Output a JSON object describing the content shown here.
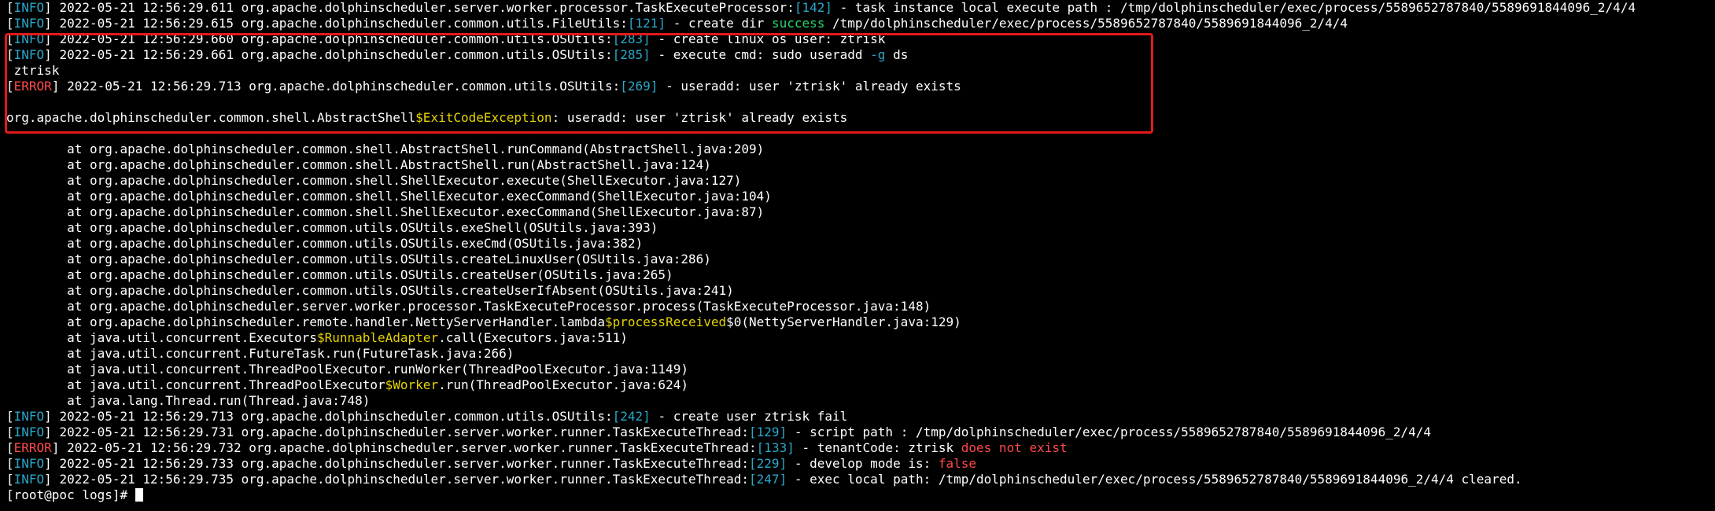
{
  "colors": {
    "background": "#000000",
    "text": "#ffffff",
    "level_info": "#2aa7c9",
    "level_error": "#ff4a4a",
    "line_number": "#2aa7c9",
    "success": "#2ad36a",
    "false_keyword": "#ff4a4a",
    "inner_class": "#e6d300",
    "flag": "#2aa7c9",
    "highlight_box": "#e21a1a"
  },
  "lines": [
    [
      {
        "t": "[",
        "c": "white"
      },
      {
        "t": "INFO",
        "c": "cyan"
      },
      {
        "t": "] 2022-05-21 12:56:29.611 org.apache.dolphinscheduler.server.worker.processor.TaskExecuteProcessor:",
        "c": "white"
      },
      {
        "t": "[142]",
        "c": "cyan"
      },
      {
        "t": " - task instance local execute path : /tmp/dolphinscheduler/exec/process/5589652787840/5589691844096_2/4/4",
        "c": "white"
      }
    ],
    [
      {
        "t": "[",
        "c": "white"
      },
      {
        "t": "INFO",
        "c": "cyan"
      },
      {
        "t": "] 2022-05-21 12:56:29.615 org.apache.dolphinscheduler.common.utils.FileUtils:",
        "c": "white"
      },
      {
        "t": "[121]",
        "c": "cyan"
      },
      {
        "t": " - create dir ",
        "c": "white"
      },
      {
        "t": "success",
        "c": "green"
      },
      {
        "t": " /tmp/dolphinscheduler/exec/process/5589652787840/5589691844096_2/4/4",
        "c": "white"
      }
    ],
    [
      {
        "t": "[",
        "c": "white"
      },
      {
        "t": "INFO",
        "c": "cyan"
      },
      {
        "t": "] 2022-05-21 12:56:29.660 org.apache.dolphinscheduler.common.utils.OSUtils:",
        "c": "white"
      },
      {
        "t": "[283]",
        "c": "cyan"
      },
      {
        "t": " - create linux os user: ztrisk",
        "c": "white"
      }
    ],
    [
      {
        "t": "[",
        "c": "white"
      },
      {
        "t": "INFO",
        "c": "cyan"
      },
      {
        "t": "] 2022-05-21 12:56:29.661 org.apache.dolphinscheduler.common.utils.OSUtils:",
        "c": "white"
      },
      {
        "t": "[285]",
        "c": "cyan"
      },
      {
        "t": " - execute cmd: sudo useradd ",
        "c": "white"
      },
      {
        "t": "-g",
        "c": "blue"
      },
      {
        "t": " ds",
        "c": "white"
      }
    ],
    [
      {
        "t": " ztrisk",
        "c": "white"
      }
    ],
    [
      {
        "t": "[",
        "c": "white"
      },
      {
        "t": "ERROR",
        "c": "red"
      },
      {
        "t": "] 2022-05-21 12:56:29.713 org.apache.dolphinscheduler.common.utils.OSUtils:",
        "c": "white"
      },
      {
        "t": "[269]",
        "c": "cyan"
      },
      {
        "t": " - useradd: user 'ztrisk' already exists",
        "c": "white"
      }
    ],
    [
      {
        "t": "",
        "c": "white"
      }
    ],
    [
      {
        "t": "org.apache.dolphinscheduler.common.shell.AbstractShell",
        "c": "white"
      },
      {
        "t": "$ExitCodeException",
        "c": "yellow"
      },
      {
        "t": ": useradd: user 'ztrisk' already exists",
        "c": "white"
      }
    ],
    [
      {
        "t": "",
        "c": "white"
      }
    ],
    [
      {
        "t": "        at org.apache.dolphinscheduler.common.shell.AbstractShell.runCommand(AbstractShell.java:209)",
        "c": "white"
      }
    ],
    [
      {
        "t": "        at org.apache.dolphinscheduler.common.shell.AbstractShell.run(AbstractShell.java:124)",
        "c": "white"
      }
    ],
    [
      {
        "t": "        at org.apache.dolphinscheduler.common.shell.ShellExecutor.execute(ShellExecutor.java:127)",
        "c": "white"
      }
    ],
    [
      {
        "t": "        at org.apache.dolphinscheduler.common.shell.ShellExecutor.execCommand(ShellExecutor.java:104)",
        "c": "white"
      }
    ],
    [
      {
        "t": "        at org.apache.dolphinscheduler.common.shell.ShellExecutor.execCommand(ShellExecutor.java:87)",
        "c": "white"
      }
    ],
    [
      {
        "t": "        at org.apache.dolphinscheduler.common.utils.OSUtils.exeShell(OSUtils.java:393)",
        "c": "white"
      }
    ],
    [
      {
        "t": "        at org.apache.dolphinscheduler.common.utils.OSUtils.exeCmd(OSUtils.java:382)",
        "c": "white"
      }
    ],
    [
      {
        "t": "        at org.apache.dolphinscheduler.common.utils.OSUtils.createLinuxUser(OSUtils.java:286)",
        "c": "white"
      }
    ],
    [
      {
        "t": "        at org.apache.dolphinscheduler.common.utils.OSUtils.createUser(OSUtils.java:265)",
        "c": "white"
      }
    ],
    [
      {
        "t": "        at org.apache.dolphinscheduler.common.utils.OSUtils.createUserIfAbsent(OSUtils.java:241)",
        "c": "white"
      }
    ],
    [
      {
        "t": "        at org.apache.dolphinscheduler.server.worker.processor.TaskExecuteProcessor.process(TaskExecuteProcessor.java:148)",
        "c": "white"
      }
    ],
    [
      {
        "t": "        at org.apache.dolphinscheduler.remote.handler.NettyServerHandler.lambda",
        "c": "white"
      },
      {
        "t": "$processReceived",
        "c": "yellow"
      },
      {
        "t": "$0(NettyServerHandler.java:129)",
        "c": "white"
      }
    ],
    [
      {
        "t": "        at java.util.concurrent.Executors",
        "c": "white"
      },
      {
        "t": "$RunnableAdapter",
        "c": "yellow"
      },
      {
        "t": ".call(Executors.java:511)",
        "c": "white"
      }
    ],
    [
      {
        "t": "        at java.util.concurrent.FutureTask.run(FutureTask.java:266)",
        "c": "white"
      }
    ],
    [
      {
        "t": "        at java.util.concurrent.ThreadPoolExecutor.runWorker(ThreadPoolExecutor.java:1149)",
        "c": "white"
      }
    ],
    [
      {
        "t": "        at java.util.concurrent.ThreadPoolExecutor",
        "c": "white"
      },
      {
        "t": "$Worker",
        "c": "yellow"
      },
      {
        "t": ".run(ThreadPoolExecutor.java:624)",
        "c": "white"
      }
    ],
    [
      {
        "t": "        at java.lang.Thread.run(Thread.java:748)",
        "c": "white"
      }
    ],
    [
      {
        "t": "[",
        "c": "white"
      },
      {
        "t": "INFO",
        "c": "cyan"
      },
      {
        "t": "] 2022-05-21 12:56:29.713 org.apache.dolphinscheduler.common.utils.OSUtils:",
        "c": "white"
      },
      {
        "t": "[242]",
        "c": "cyan"
      },
      {
        "t": " - create user ztrisk fail",
        "c": "white"
      }
    ],
    [
      {
        "t": "[",
        "c": "white"
      },
      {
        "t": "INFO",
        "c": "cyan"
      },
      {
        "t": "] 2022-05-21 12:56:29.731 org.apache.dolphinscheduler.server.worker.runner.TaskExecuteThread:",
        "c": "white"
      },
      {
        "t": "[129]",
        "c": "cyan"
      },
      {
        "t": " - script path : /tmp/dolphinscheduler/exec/process/5589652787840/5589691844096_2/4/4",
        "c": "white"
      }
    ],
    [
      {
        "t": "[",
        "c": "white"
      },
      {
        "t": "ERROR",
        "c": "red"
      },
      {
        "t": "] 2022-05-21 12:56:29.732 org.apache.dolphinscheduler.server.worker.runner.TaskExecuteThread:",
        "c": "white"
      },
      {
        "t": "[133]",
        "c": "cyan"
      },
      {
        "t": " - tenantCode: ztrisk ",
        "c": "white"
      },
      {
        "t": "does not exist",
        "c": "red"
      }
    ],
    [
      {
        "t": "[",
        "c": "white"
      },
      {
        "t": "INFO",
        "c": "cyan"
      },
      {
        "t": "] 2022-05-21 12:56:29.733 org.apache.dolphinscheduler.server.worker.runner.TaskExecuteThread:",
        "c": "white"
      },
      {
        "t": "[229]",
        "c": "cyan"
      },
      {
        "t": " - develop mode is: ",
        "c": "white"
      },
      {
        "t": "false",
        "c": "red"
      }
    ],
    [
      {
        "t": "[",
        "c": "white"
      },
      {
        "t": "INFO",
        "c": "cyan"
      },
      {
        "t": "] 2022-05-21 12:56:29.735 org.apache.dolphinscheduler.server.worker.runner.TaskExecuteThread:",
        "c": "white"
      },
      {
        "t": "[247]",
        "c": "cyan"
      },
      {
        "t": " - exec local path: /tmp/dolphinscheduler/exec/process/5589652787840/5589691844096_2/4/4 cleared.",
        "c": "white"
      }
    ]
  ],
  "prompt": "[root@poc logs]# "
}
